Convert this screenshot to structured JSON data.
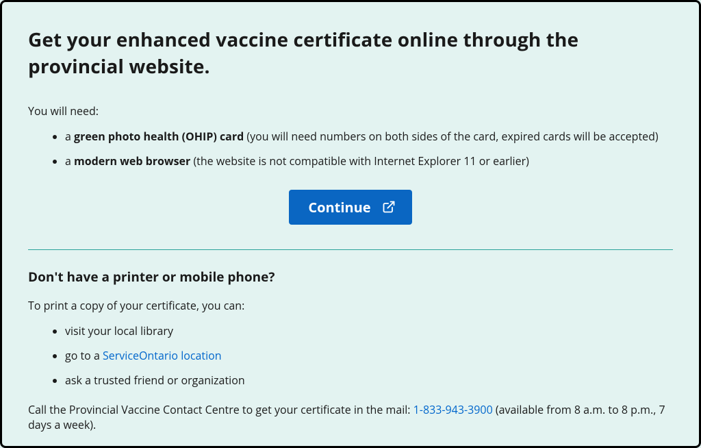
{
  "heading": "Get your enhanced vaccine certificate online through the provincial website.",
  "intro": "You will need:",
  "requirements": [
    {
      "prefix": "a ",
      "bold": "green photo health (OHIP) card",
      "suffix": " (you will need numbers on both sides of the card, expired cards will be accepted)"
    },
    {
      "prefix": "a ",
      "bold": "modern web browser",
      "suffix": " (the website is not compatible with Internet Explorer 11 or earlier)"
    }
  ],
  "continue_label": "Continue",
  "subheading": "Don't have a printer or mobile phone?",
  "print_intro": "To print a copy of your certificate, you can:",
  "options": {
    "opt0": "visit your local library",
    "opt1_prefix": "go to a ",
    "opt1_link": "ServiceOntario location",
    "opt2": "ask a trusted friend or organization"
  },
  "footer": {
    "pre": "Call the Provincial Vaccine Contact Centre to get your certificate in the mail: ",
    "phone": "1-833-943-3900",
    "post": " (available from 8 a.m. to 8 p.m., 7 days a week)."
  }
}
